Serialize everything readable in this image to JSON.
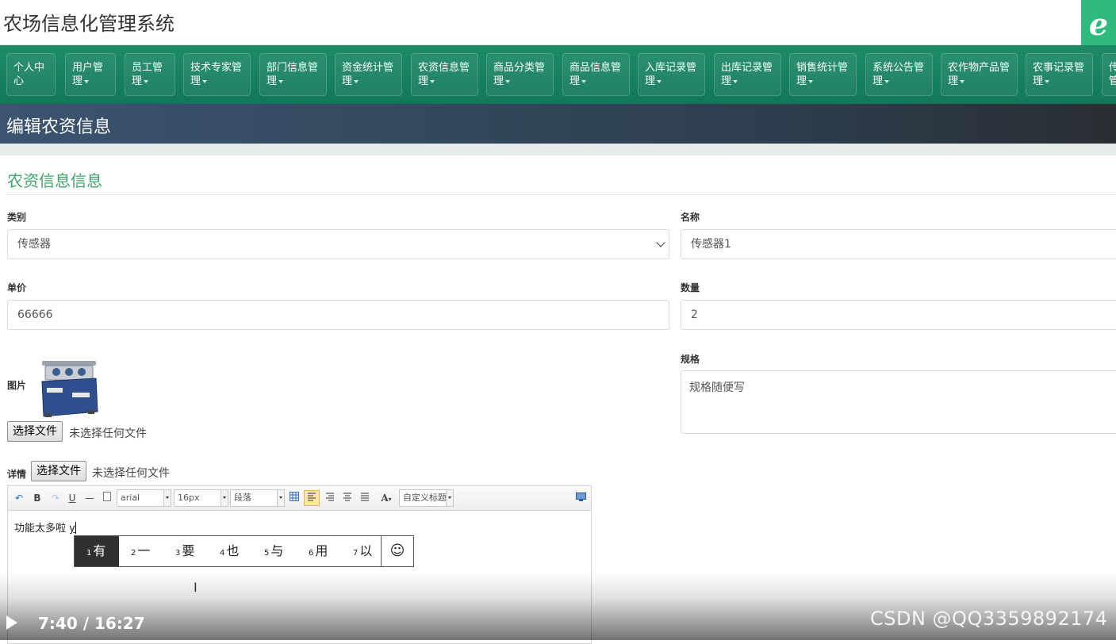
{
  "app": {
    "title": "农场信息化管理系统",
    "logo_icon": "ie-e-icon",
    "logo_color": "#2fbb7c"
  },
  "nav": {
    "items": [
      {
        "label": "个人中心"
      },
      {
        "label": "用户管理"
      },
      {
        "label": "员工管理"
      },
      {
        "label": "技术专家管理"
      },
      {
        "label": "部门信息管理"
      },
      {
        "label": "资金统计管理"
      },
      {
        "label": "农资信息管理"
      },
      {
        "label": "商品分类管理"
      },
      {
        "label": "商品信息管理"
      },
      {
        "label": "入库记录管理"
      },
      {
        "label": "出库记录管理"
      },
      {
        "label": "销售统计管理"
      },
      {
        "label": "系统公告管理"
      },
      {
        "label": "农作物产品管理"
      },
      {
        "label": "农事记录管理"
      },
      {
        "label": "传感器管理"
      }
    ]
  },
  "page": {
    "title": "编辑农资信息"
  },
  "panel": {
    "title": "农资信息信息"
  },
  "form": {
    "category": {
      "label": "类别",
      "value": "传感器"
    },
    "name": {
      "label": "名称",
      "value": "传感器1"
    },
    "price": {
      "label": "单价",
      "value": "66666"
    },
    "quantity": {
      "label": "数量",
      "value": "2"
    },
    "image": {
      "label": "图片",
      "button": "选择文件",
      "status": "未选择任何文件"
    },
    "spec": {
      "label": "规格",
      "value": "规格随便写"
    },
    "details": {
      "label": "详情",
      "button": "选择文件",
      "status": "未选择任何文件"
    }
  },
  "editor": {
    "toolbar": {
      "bold": "B",
      "underline": "U",
      "hr": "—",
      "font_family": "arial",
      "font_size": "16px",
      "paragraph": "段落",
      "font_color": "A",
      "custom_title": "自定义标题"
    },
    "content": "功能太多啦",
    "composition": "y"
  },
  "ime": {
    "candidates": [
      {
        "index": "1",
        "text": "有"
      },
      {
        "index": "2",
        "text": "一"
      },
      {
        "index": "3",
        "text": "要"
      },
      {
        "index": "4",
        "text": "也"
      },
      {
        "index": "5",
        "text": "与"
      },
      {
        "index": "6",
        "text": "用"
      },
      {
        "index": "7",
        "text": "以"
      }
    ],
    "selected_index": 0,
    "emoji": "☺"
  },
  "video": {
    "time": "7:40 / 16:27"
  },
  "watermark": "CSDN @QQ3359892174",
  "colors": {
    "nav_bg": "#1a845f",
    "accent_green": "#3fa56c",
    "page_head": "#34495e"
  }
}
